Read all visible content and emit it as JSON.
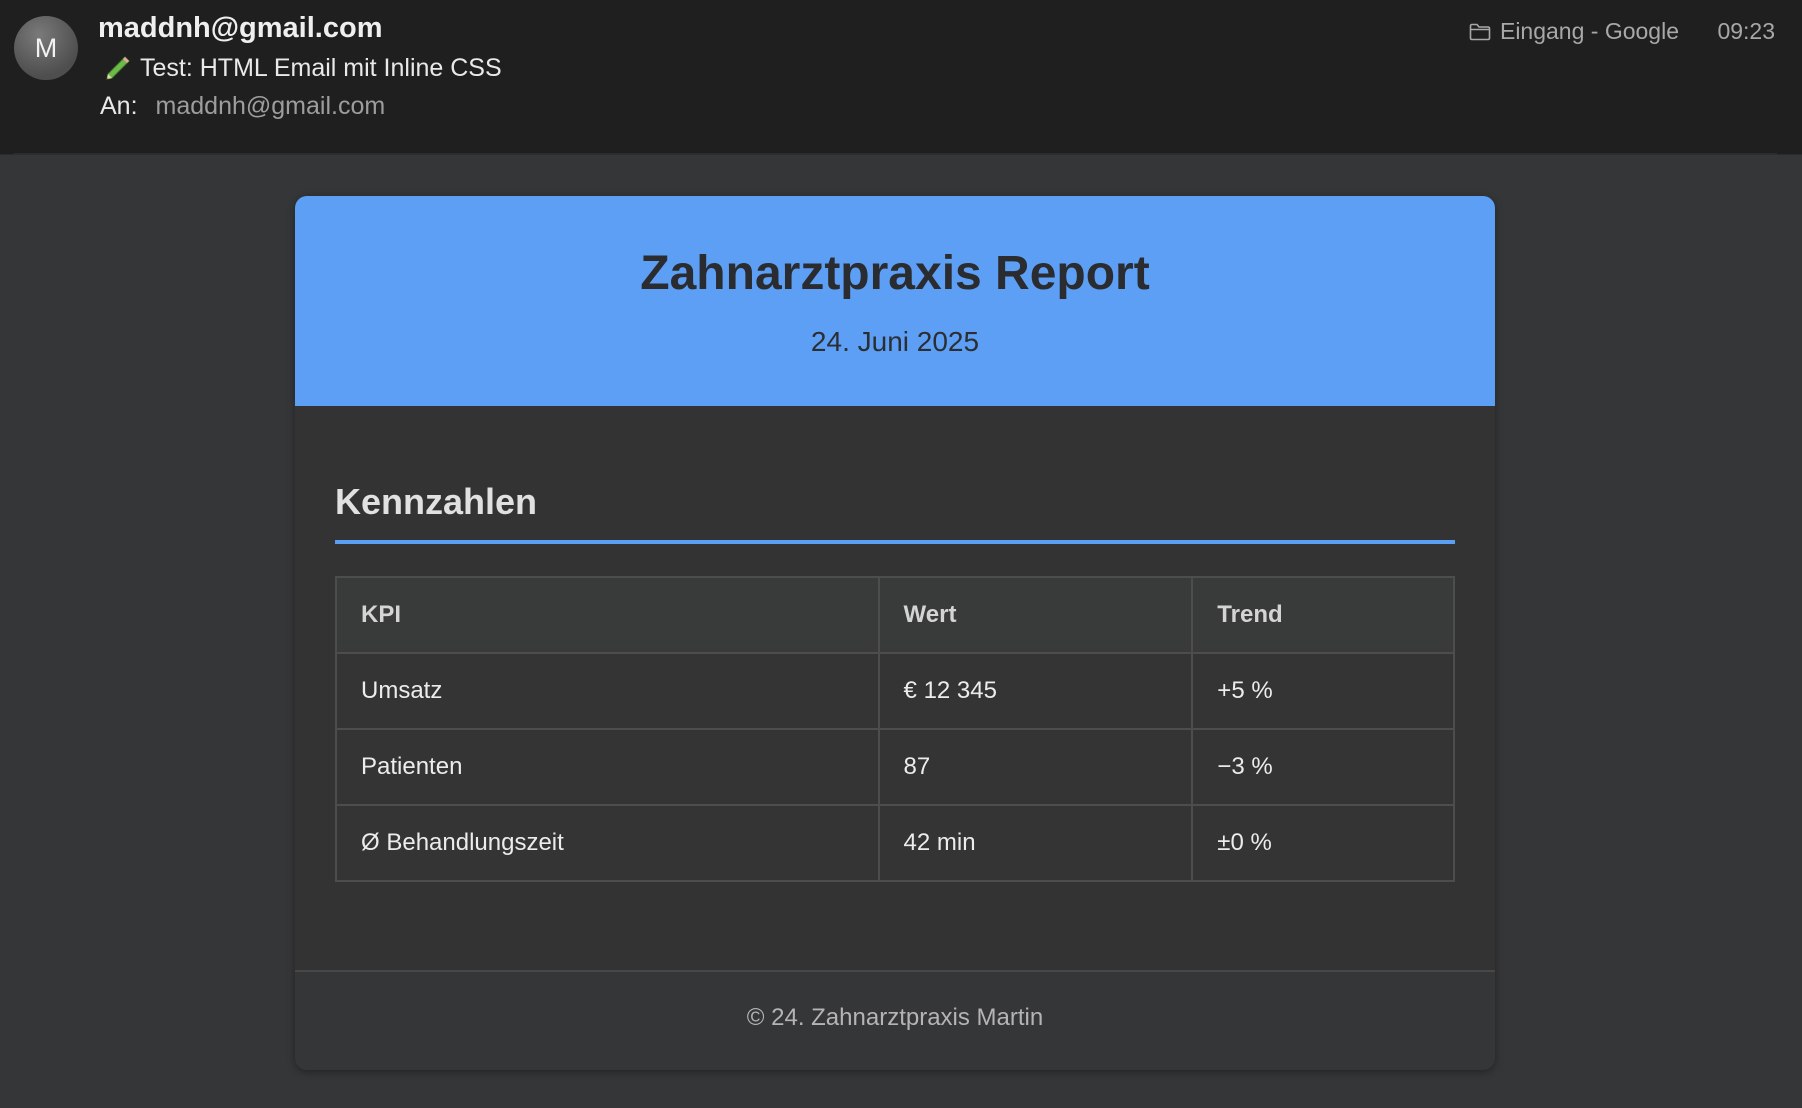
{
  "email": {
    "avatar_initial": "M",
    "from": "maddnh@gmail.com",
    "subject": "Test: HTML Email mit Inline CSS",
    "to_label": "An:",
    "to": "maddnh@gmail.com",
    "folder": "Eingang - Google",
    "time": "09:23"
  },
  "report": {
    "title": "Zahnarztpraxis Report",
    "date": "24. Juni 2025",
    "section_title": "Kennzahlen",
    "table": {
      "headers": [
        "KPI",
        "Wert",
        "Trend"
      ],
      "rows": [
        [
          "Umsatz",
          "€ 12 345",
          "+5 %"
        ],
        [
          "Patienten",
          "87",
          "−3 %"
        ],
        [
          "Ø Behandlungszeit",
          "42 min",
          "±0 %"
        ]
      ]
    },
    "footer": "© 24. Zahnarztpraxis Martin"
  },
  "colors": {
    "banner": "#5d9ff5",
    "accent_rule": "#5b9ff2",
    "background": "#353637",
    "header_bg": "#1f1f1f"
  },
  "icons": {
    "subject_icon": "pencil-icon",
    "folder_icon": "folder-icon"
  }
}
